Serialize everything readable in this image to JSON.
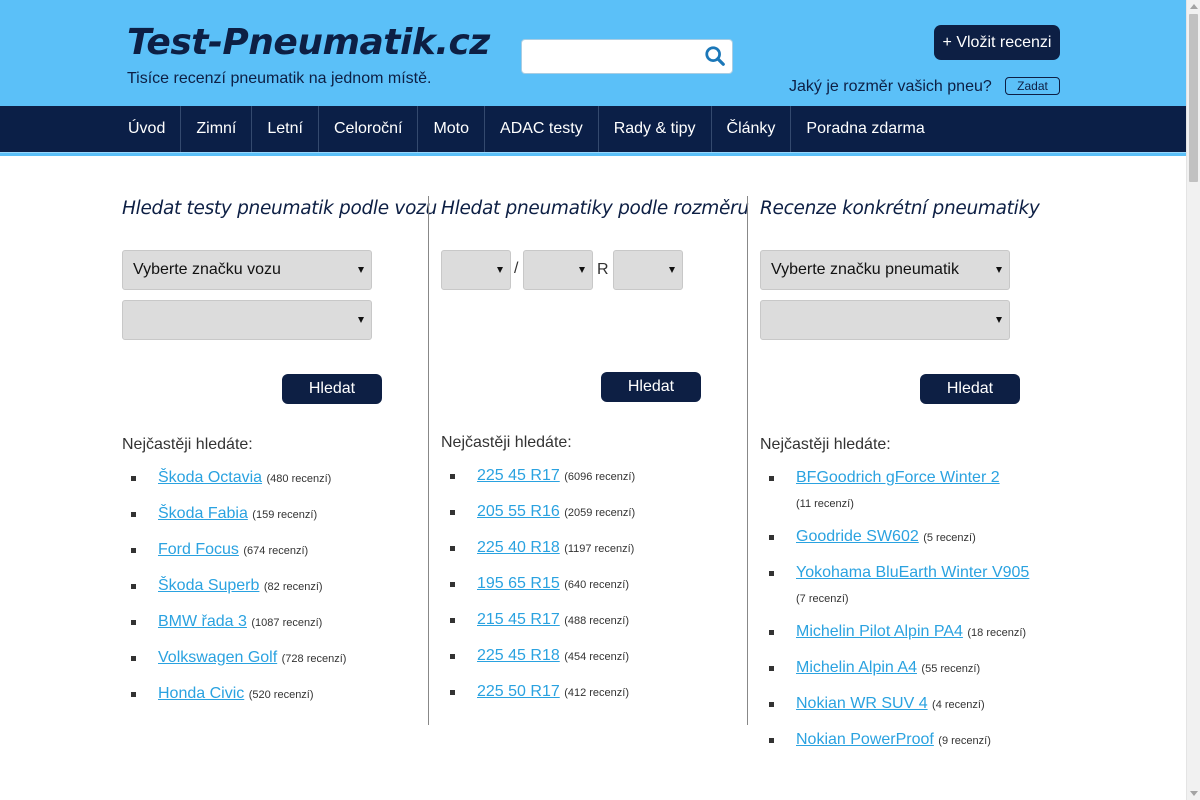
{
  "header": {
    "logo": "Test-Pneumatik.cz",
    "tagline": "Tisíce recenzí pneumatik na jednom místě.",
    "search_placeholder": "",
    "add_review_label": "+ Vložit recenzi",
    "size_question": "Jaký je rozměr vašich pneu?",
    "size_button_label": "Zadat"
  },
  "nav": {
    "items": [
      "Úvod",
      "Zimní",
      "Letní",
      "Celoroční",
      "Moto",
      "ADAC testy",
      "Rady & tipy",
      "Články",
      "Poradna zdarma"
    ]
  },
  "columns": {
    "car": {
      "title": "Hledat testy pneumatik podle vozu",
      "brand_select": "Vyberte značku vozu",
      "model_select": "",
      "button": "Hledat",
      "freq_title": "Nejčastěji hledáte:",
      "items": [
        {
          "label": "Škoda Octavia",
          "count": "(480 recenzí)"
        },
        {
          "label": "Škoda Fabia",
          "count": "(159 recenzí)"
        },
        {
          "label": "Ford Focus",
          "count": "(674 recenzí)"
        },
        {
          "label": "Škoda Superb",
          "count": "(82 recenzí)"
        },
        {
          "label": "BMW řada 3",
          "count": "(1087 recenzí)"
        },
        {
          "label": "Volkswagen Golf",
          "count": "(728 recenzí)"
        },
        {
          "label": "Honda Civic",
          "count": "(520 recenzí)"
        }
      ]
    },
    "size": {
      "title": "Hledat pneumatiky podle rozměru",
      "slash": "/",
      "r": "R",
      "button": "Hledat",
      "freq_title": "Nejčastěji hledáte:",
      "items": [
        {
          "label": "225 45 R17",
          "count": "(6096 recenzí)"
        },
        {
          "label": "205 55 R16",
          "count": "(2059 recenzí)"
        },
        {
          "label": "225 40 R18",
          "count": "(1197 recenzí)"
        },
        {
          "label": "195 65 R15",
          "count": "(640 recenzí)"
        },
        {
          "label": "215 45 R17",
          "count": "(488 recenzí)"
        },
        {
          "label": "225 45 R18",
          "count": "(454 recenzí)"
        },
        {
          "label": "225 50 R17",
          "count": "(412 recenzí)"
        }
      ]
    },
    "tire": {
      "title": "Recenze konkrétní pneumatiky",
      "brand_select": "Vyberte značku pneumatik",
      "model_select": "",
      "button": "Hledat",
      "freq_title": "Nejčastěji hledáte:",
      "items": [
        {
          "label": "BFGoodrich gForce Winter 2",
          "count": "(11 recenzí)"
        },
        {
          "label": "Goodride SW602",
          "count": "(5 recenzí)"
        },
        {
          "label": "Yokohama BluEarth Winter V905",
          "count": "(7 recenzí)"
        },
        {
          "label": "Michelin Pilot Alpin PA4",
          "count": "(18 recenzí)"
        },
        {
          "label": "Michelin Alpin A4",
          "count": "(55 recenzí)"
        },
        {
          "label": "Nokian WR SUV 4",
          "count": "(4 recenzí)"
        },
        {
          "label": "Nokian PowerProof",
          "count": "(9 recenzí)"
        }
      ]
    }
  },
  "colors": {
    "header_bg": "#5bc0f8",
    "nav_bg": "#0b1f47",
    "button_bg": "#0d1f44",
    "link": "#2aa2e0"
  }
}
